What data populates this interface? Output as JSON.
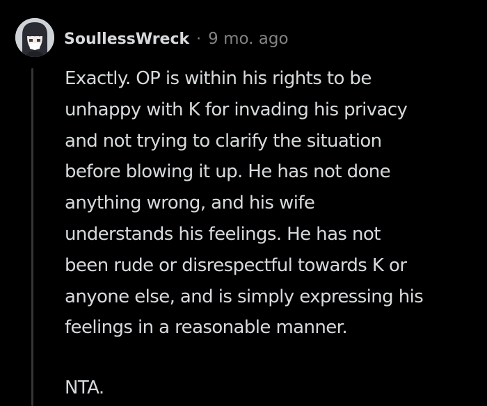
{
  "comment": {
    "username": "SoullessWreck",
    "separator": "·",
    "timestamp": "9 mo. ago",
    "paragraphs": [
      {
        "lines": [
          "Exactly. OP is within his rights to be",
          "unhappy with K for invading his privacy",
          "and not trying to clarify the situation",
          "before blowing it up. He has not done",
          "anything wrong, and his wife",
          "understands his feelings. He has not",
          "been rude or disrespectful towards K or",
          "anyone else, and is simply expressing his",
          "feelings in a reasonable manner."
        ]
      },
      {
        "lines": [
          "NTA."
        ]
      }
    ]
  },
  "colors": {
    "background": "#000000",
    "text": "#d7dadc",
    "meta": "#818384",
    "thread_line": "#343536"
  },
  "icons": {
    "avatar": "anime-girl-avatar-icon"
  }
}
